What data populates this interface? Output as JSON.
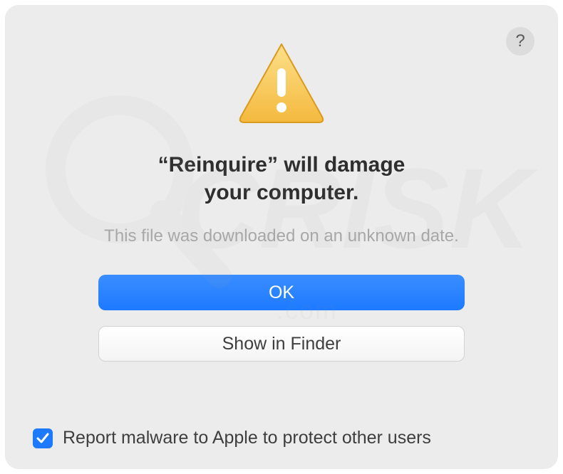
{
  "help": "?",
  "title_line1": "“Reinquire” will damage",
  "title_line2": "your computer.",
  "subtitle": "This file was downloaded on an unknown date.",
  "buttons": {
    "ok": "OK",
    "show_in_finder": "Show in Finder"
  },
  "checkbox": {
    "checked": true,
    "label": "Report malware to Apple to protect other users"
  },
  "icons": {
    "warning": "warning-triangle",
    "help": "help-circle",
    "check": "checkmark"
  },
  "colors": {
    "primary": "#1d7aff",
    "warning_fill": "#f5c842",
    "warning_stroke": "#e0a820",
    "subtitle_grey": "#a8a8a8",
    "dialog_bg": "#ececec"
  }
}
